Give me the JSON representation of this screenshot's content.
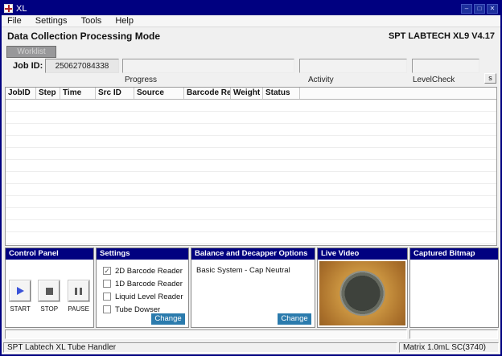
{
  "window": {
    "title": "XL",
    "controls": {
      "minimize": "–",
      "maximize": "□",
      "close": "✕"
    }
  },
  "menu": {
    "items": [
      "File",
      "Settings",
      "Tools",
      "Help"
    ]
  },
  "header": {
    "title": "Data Collection Processing Mode",
    "version": "SPT LABTECH XL9 V4.17"
  },
  "toolbar": {
    "worklist": "Worklist",
    "job_id_label": "Job ID:",
    "job_id_value": "250627084338",
    "progress_label": "Progress",
    "activity_label": "Activity",
    "levelcheck_label": "LevelCheck",
    "s_button": "s"
  },
  "table": {
    "columns": [
      "JobID",
      "Step",
      "Time",
      "Src ID",
      "Source",
      "Barcode Re...",
      "Weight",
      "Status"
    ]
  },
  "panels": {
    "control": {
      "title": "Control Panel",
      "start": "START",
      "stop": "STOP",
      "pause": "PAUSE"
    },
    "settings": {
      "title": "Settings",
      "options": [
        {
          "label": "2D Barcode Reader",
          "mark": "✓"
        },
        {
          "label": "1D Barcode Reader",
          "mark": ""
        },
        {
          "label": "Liquid Level Reader",
          "mark": ""
        },
        {
          "label": "Tube Dowser",
          "mark": ""
        }
      ],
      "change": "Change"
    },
    "balance": {
      "title": "Balance and Decapper Options",
      "text": "Basic System - Cap Neutral",
      "change": "Change"
    },
    "video": {
      "title": "Live Video"
    },
    "bitmap": {
      "title": "Captured Bitmap"
    }
  },
  "statusbar": {
    "left": "SPT Labtech XL Tube Handler",
    "right": "Matrix 1.0mL SC(3740)"
  },
  "colors": {
    "titlebar": "#000080",
    "panel_header": "#000080",
    "change_button": "#2b7bad",
    "video_background": "#a96f2a",
    "start_icon": "#3a52d8"
  }
}
